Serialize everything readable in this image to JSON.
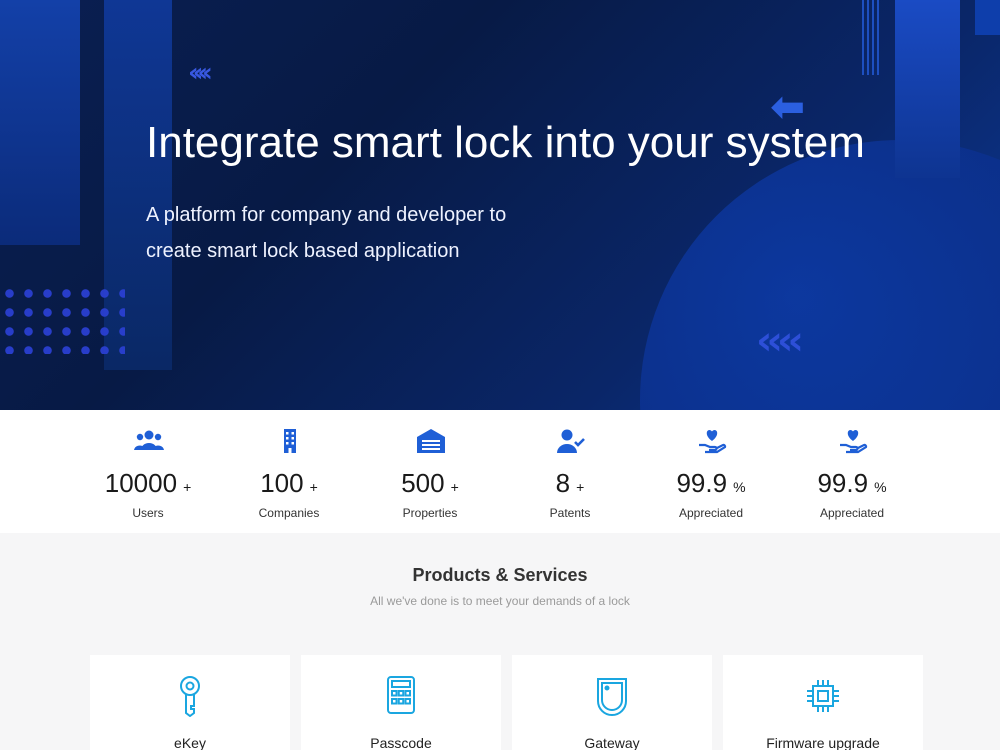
{
  "hero": {
    "title": "Integrate smart lock into your system",
    "subtitle_line1": "A platform for company and developer to",
    "subtitle_line2": "create smart lock based application"
  },
  "stats": [
    {
      "icon": "users-icon",
      "value": "10000",
      "suffix": "+",
      "label": "Users"
    },
    {
      "icon": "building-icon",
      "value": "100",
      "suffix": "+",
      "label": "Companies"
    },
    {
      "icon": "garage-icon",
      "value": "500",
      "suffix": "+",
      "label": "Properties"
    },
    {
      "icon": "user-check-icon",
      "value": "8",
      "suffix": "+",
      "label": "Patents"
    },
    {
      "icon": "hand-heart-icon",
      "value": "99.9",
      "suffix": "%",
      "label": "Appreciated"
    },
    {
      "icon": "hand-heart-icon",
      "value": "99.9",
      "suffix": "%",
      "label": "Appreciated"
    }
  ],
  "products": {
    "title": "Products & Services",
    "subtitle": "All we've done is to meet your demands of a lock",
    "items": [
      {
        "icon": "key-icon",
        "label": "eKey"
      },
      {
        "icon": "keypad-icon",
        "label": "Passcode"
      },
      {
        "icon": "gateway-icon",
        "label": "Gateway"
      },
      {
        "icon": "chip-icon",
        "label": "Firmware upgrade"
      }
    ]
  },
  "colors": {
    "accent": "#1f5fd6",
    "hero_bg": "#071a45",
    "product_icon": "#1aa6e0"
  }
}
